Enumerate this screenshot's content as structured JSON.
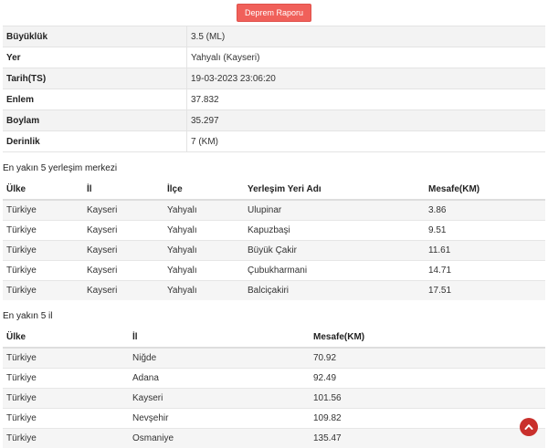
{
  "header": {
    "report_button": "Deprem Raporu"
  },
  "details": [
    {
      "label": "Büyüklük",
      "value": "3.5 (ML)"
    },
    {
      "label": "Yer",
      "value": "Yahyalı (Kayseri)"
    },
    {
      "label": "Tarih(TS)",
      "value": "19-03-2023 23:06:20"
    },
    {
      "label": "Enlem",
      "value": "37.832"
    },
    {
      "label": "Boylam",
      "value": "35.297"
    },
    {
      "label": "Derinlik",
      "value": "7 (KM)"
    }
  ],
  "settlements": {
    "title": "En yakın 5 yerleşim merkezi",
    "headers": [
      "Ülke",
      "İl",
      "İlçe",
      "Yerleşim Yeri Adı",
      "Mesafe(KM)"
    ],
    "rows": [
      [
        "Türkiye",
        "Kayseri",
        "Yahyalı",
        "Ulupinar",
        "3.86"
      ],
      [
        "Türkiye",
        "Kayseri",
        "Yahyalı",
        "Kapuzbaşi",
        "9.51"
      ],
      [
        "Türkiye",
        "Kayseri",
        "Yahyalı",
        "Büyük Çakir",
        "11.61"
      ],
      [
        "Türkiye",
        "Kayseri",
        "Yahyalı",
        "Çubukharmani",
        "14.71"
      ],
      [
        "Türkiye",
        "Kayseri",
        "Yahyalı",
        "Balciçakiri",
        "17.51"
      ]
    ]
  },
  "provinces": {
    "title": "En yakın 5 il",
    "headers": [
      "Ülke",
      "İl",
      "Mesafe(KM)"
    ],
    "rows": [
      [
        "Türkiye",
        "Niğde",
        "70.92"
      ],
      [
        "Türkiye",
        "Adana",
        "92.49"
      ],
      [
        "Türkiye",
        "Kayseri",
        "101.56"
      ],
      [
        "Türkiye",
        "Nevşehir",
        "109.82"
      ],
      [
        "Türkiye",
        "Osmaniye",
        "135.47"
      ]
    ]
  },
  "icons": {
    "scroll_top": "chevron-up-icon"
  },
  "colors": {
    "accent": "#f0605a",
    "scroll_button": "#c9302c"
  }
}
